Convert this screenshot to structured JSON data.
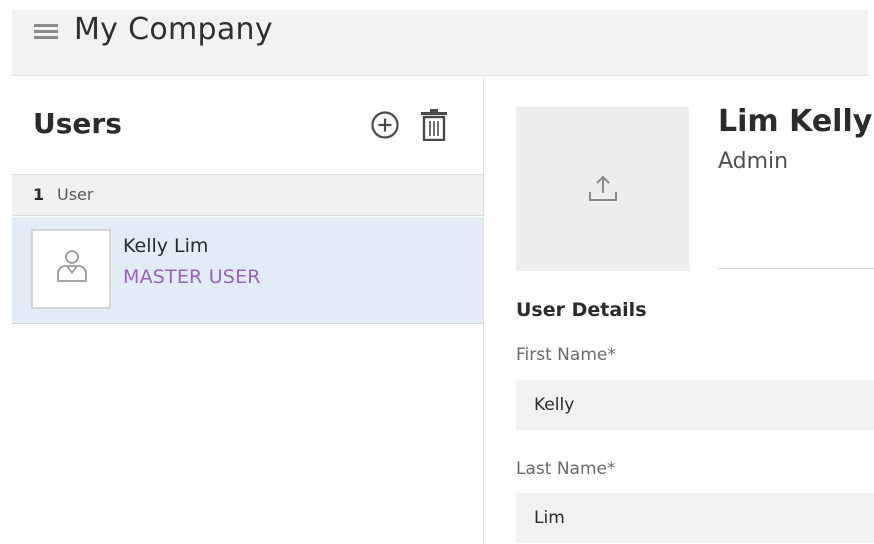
{
  "header": {
    "title": "My Company"
  },
  "users_panel": {
    "title": "Users",
    "count": "1",
    "count_label": "User",
    "items": [
      {
        "name": "Kelly Lim",
        "role": "MASTER USER"
      }
    ]
  },
  "profile": {
    "name": "Lim Kelly",
    "role": "Admin",
    "section_title": "User Details",
    "fields": [
      {
        "label": "First Name*",
        "value": "Kelly"
      },
      {
        "label": "Last Name*",
        "value": "Lim"
      }
    ]
  },
  "colors": {
    "selected_row": "#e1ecf7",
    "role_accent": "#9b5fc0",
    "header_bg": "#f2f2f2",
    "input_bg": "#f1f1f1"
  },
  "icons": {
    "menu": "hamburger-menu-icon",
    "add": "add-circle-icon",
    "delete": "trash-icon",
    "avatar": "user-placeholder-icon",
    "upload": "upload-icon"
  }
}
